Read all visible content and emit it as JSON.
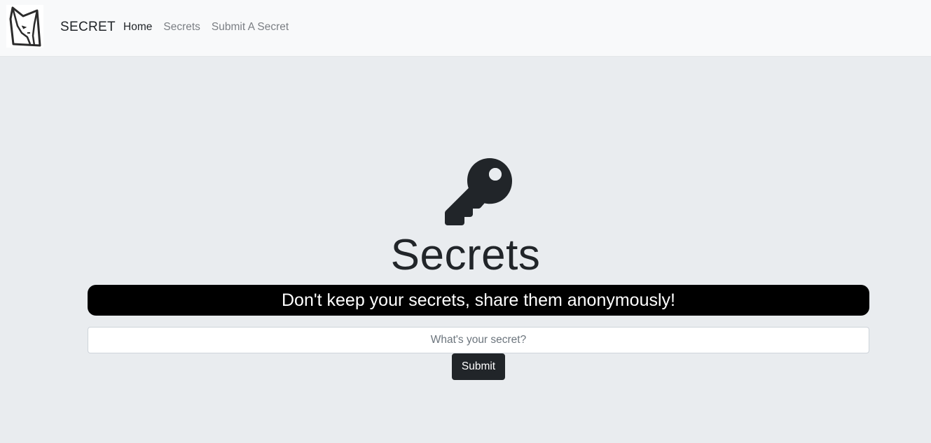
{
  "navbar": {
    "logo_icon": "fox-logo-icon",
    "brand": "SECRET",
    "links": [
      {
        "label": "Home",
        "active": true
      },
      {
        "label": "Secrets",
        "active": false
      },
      {
        "label": "Submit A Secret",
        "active": false
      }
    ]
  },
  "hero": {
    "icon": "key-icon",
    "title": "Secrets",
    "tagline": "Don't keep your secrets, share them anonymously!"
  },
  "form": {
    "placeholder": "What's your secret?",
    "value": "",
    "submit_label": "Submit"
  },
  "colors": {
    "navbar_bg": "#f8f9fa",
    "page_bg": "#e9ecef",
    "dark": "#212529",
    "tagline_bg": "#000000"
  }
}
